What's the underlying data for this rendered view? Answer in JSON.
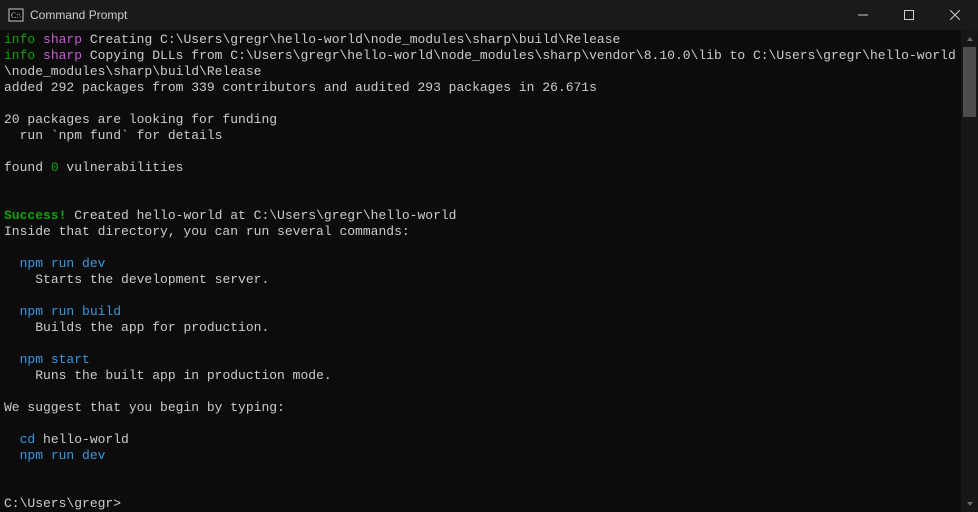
{
  "window": {
    "title": "Command Prompt"
  },
  "line1": {
    "info": "info",
    "sharp": "sharp",
    "rest": " Creating C:\\Users\\gregr\\hello-world\\node_modules\\sharp\\build\\Release"
  },
  "line2": {
    "info": "info",
    "sharp": "sharp",
    "rest": " Copying DLLs from C:\\Users\\gregr\\hello-world\\node_modules\\sharp\\vendor\\8.10.0\\lib to C:\\Users\\gregr\\hello-world\\node_modules\\sharp\\build\\Release"
  },
  "line3": "added 292 packages from 339 contributors and audited 293 packages in 26.671s",
  "line4": "20 packages are looking for funding",
  "line5": "  run `npm fund` for details",
  "vuln": {
    "a": "found ",
    "zero": "0",
    "b": " vulnerabilities"
  },
  "success": {
    "label": "Success!",
    "rest": " Created hello-world at C:\\Users\\gregr\\hello-world"
  },
  "inside": "Inside that directory, you can run several commands:",
  "cmd1": {
    "cmd": "  npm run dev",
    "desc": "    Starts the development server."
  },
  "cmd2": {
    "cmd": "  npm run build",
    "desc": "    Builds the app for production."
  },
  "cmd3": {
    "cmd": "  npm start",
    "desc": "    Runs the built app in production mode."
  },
  "suggest": "We suggest that you begin by typing:",
  "cd": {
    "a": "  cd ",
    "b": "hello-world"
  },
  "rundev": "  npm run dev",
  "prompt": "C:\\Users\\gregr>"
}
